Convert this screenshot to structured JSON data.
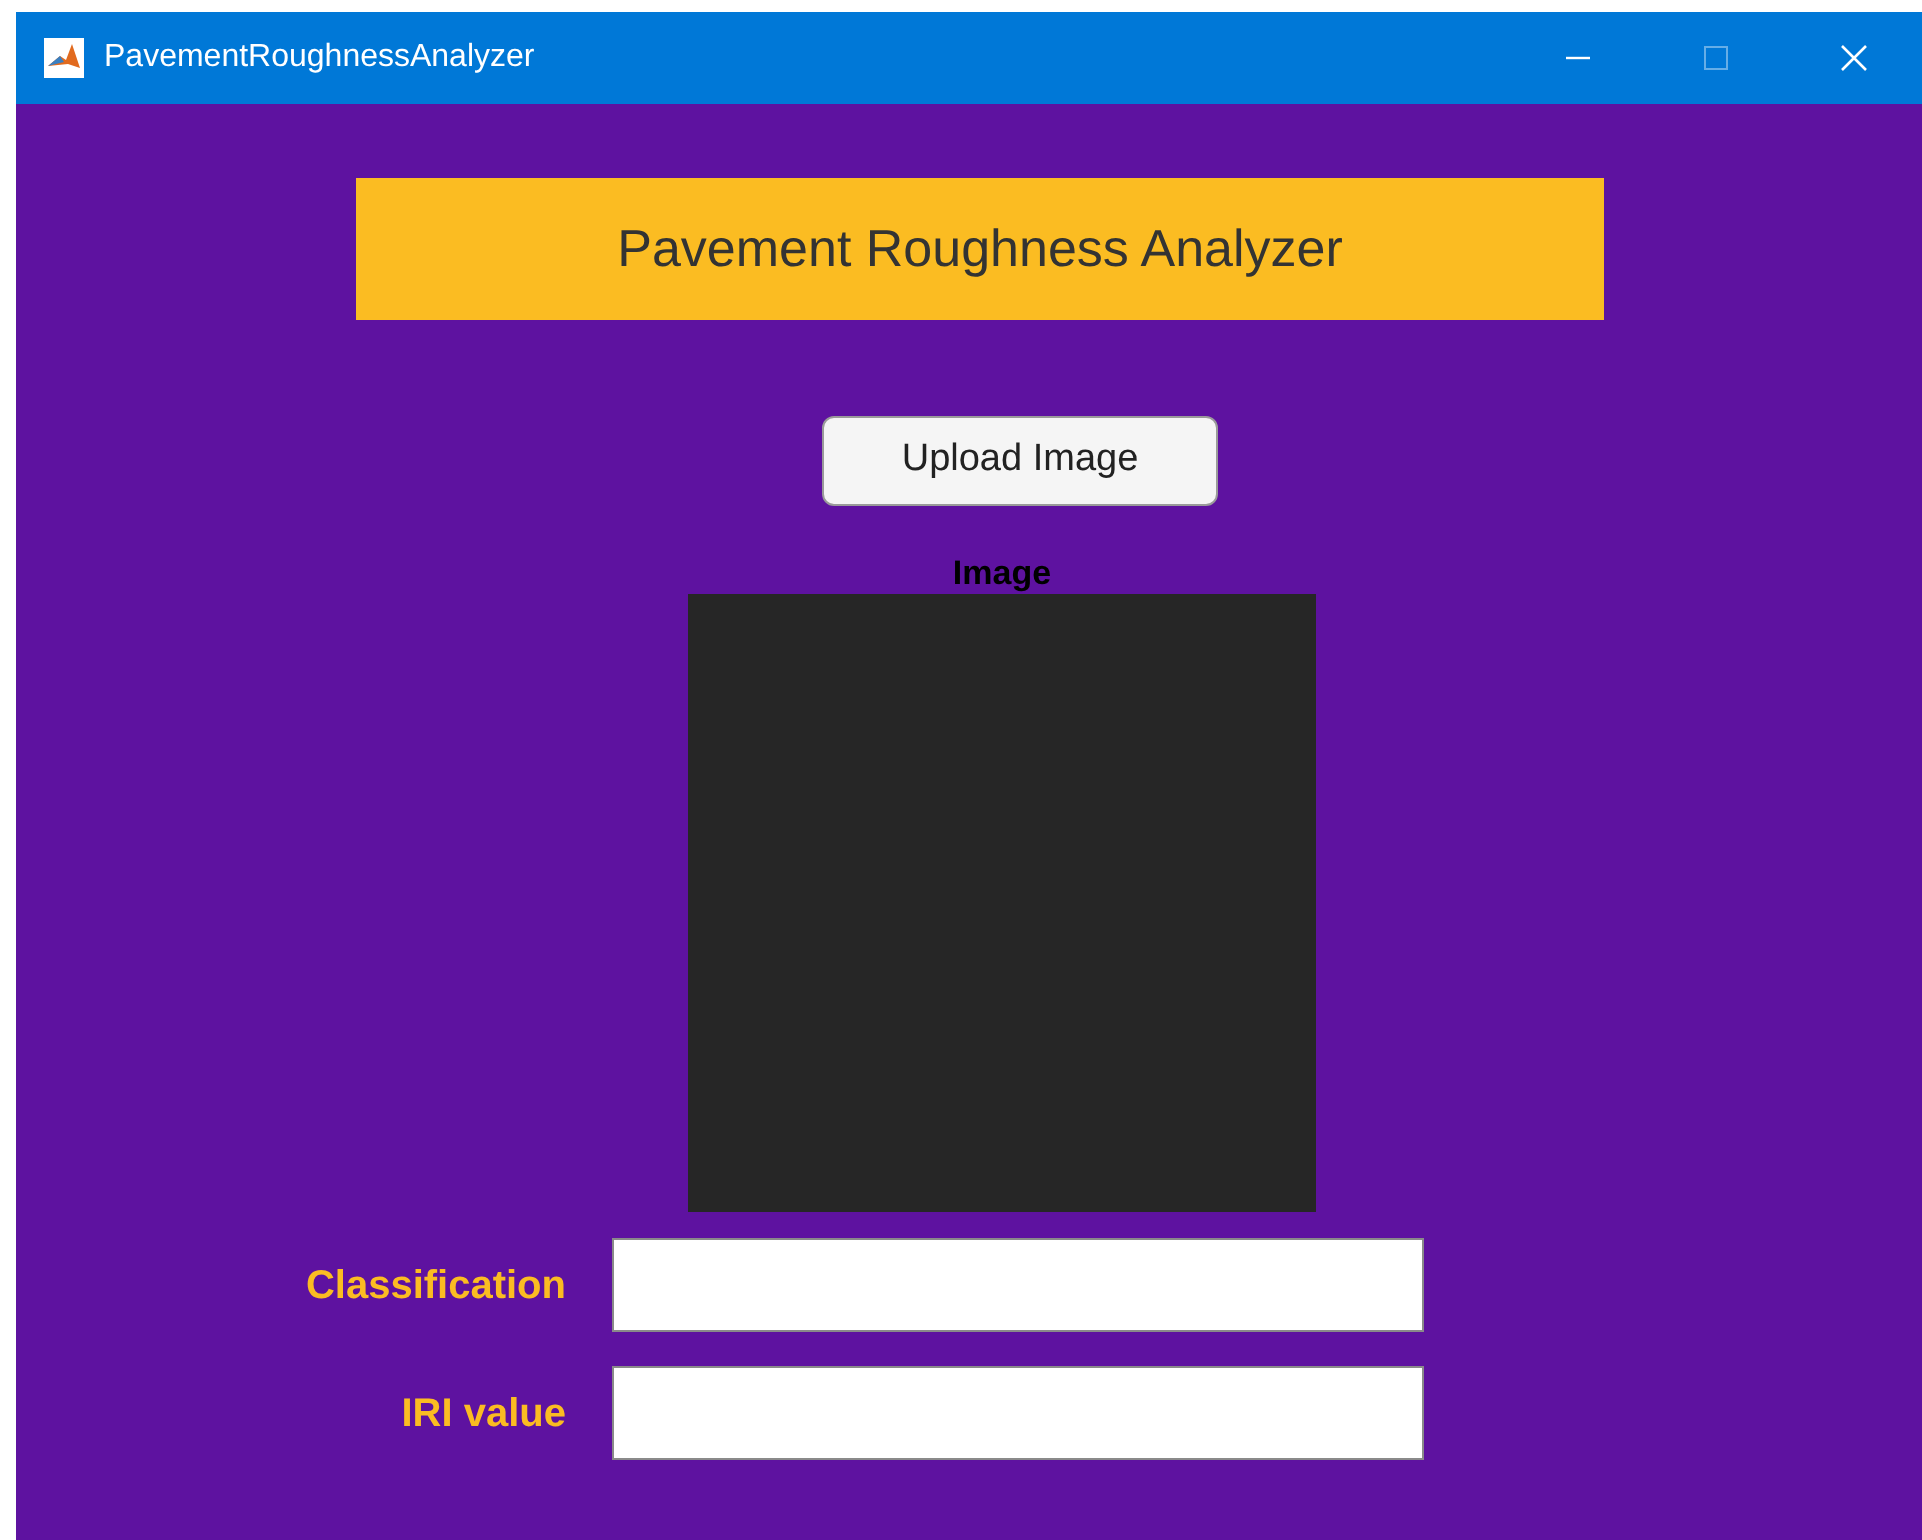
{
  "window": {
    "title": "PavementRoughnessAnalyzer",
    "maximize_disabled": true
  },
  "banner": {
    "title": "Pavement Roughness Analyzer"
  },
  "upload_button": {
    "label": "Upload Image"
  },
  "image_panel": {
    "title": "Image"
  },
  "fields": [
    {
      "label": "Classification"
    },
    {
      "label": "IRI value"
    }
  ]
}
